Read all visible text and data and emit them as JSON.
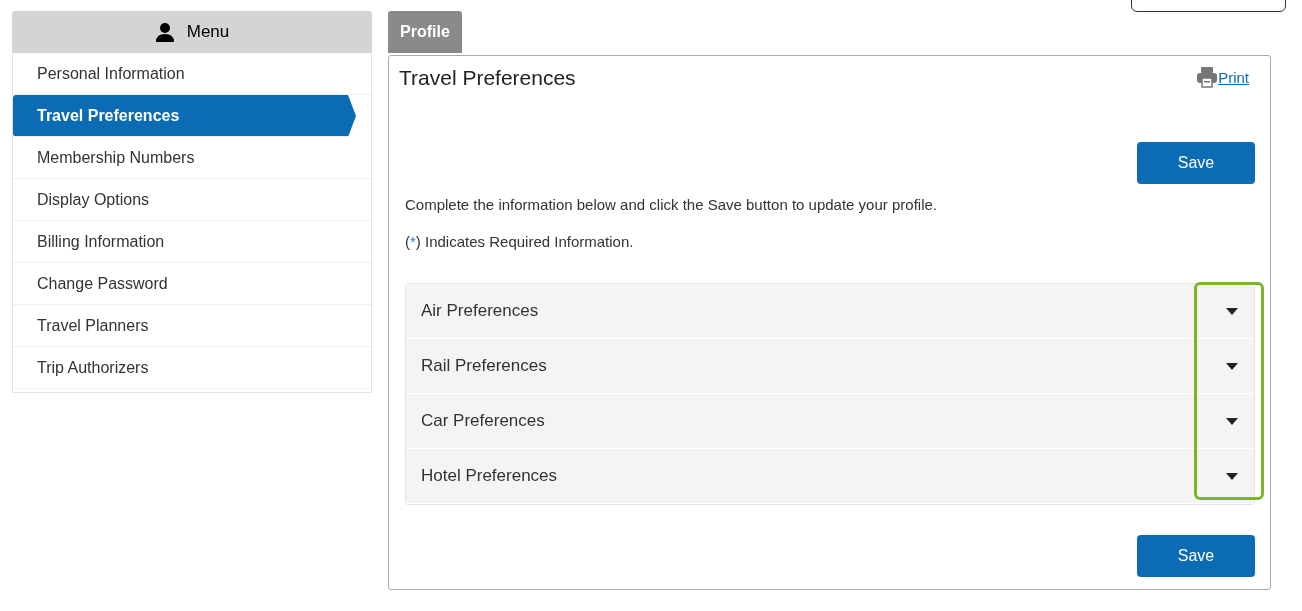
{
  "sidebar": {
    "title": "Menu",
    "items": [
      {
        "label": "Personal Information",
        "selected": false
      },
      {
        "label": "Travel Preferences",
        "selected": true
      },
      {
        "label": "Membership Numbers",
        "selected": false
      },
      {
        "label": "Display Options",
        "selected": false
      },
      {
        "label": "Billing Information",
        "selected": false
      },
      {
        "label": "Change Password",
        "selected": false
      },
      {
        "label": "Travel Planners",
        "selected": false
      },
      {
        "label": "Trip Authorizers",
        "selected": false
      }
    ]
  },
  "tabs": [
    {
      "label": "Profile",
      "selected": true
    }
  ],
  "panel": {
    "title": "Travel Preferences",
    "print": "Print",
    "save": "Save",
    "instructions": "Complete the information below and click the Save button to update your profile.",
    "required_note": {
      "before": "(",
      "mark": "*",
      "after": ") Indicates Required Information."
    },
    "sections": [
      {
        "label": "Air Preferences",
        "expanded": false
      },
      {
        "label": "Rail Preferences",
        "expanded": false
      },
      {
        "label": "Car Preferences",
        "expanded": false
      },
      {
        "label": "Hotel Preferences",
        "expanded": false
      }
    ],
    "save_bottom": "Save"
  }
}
